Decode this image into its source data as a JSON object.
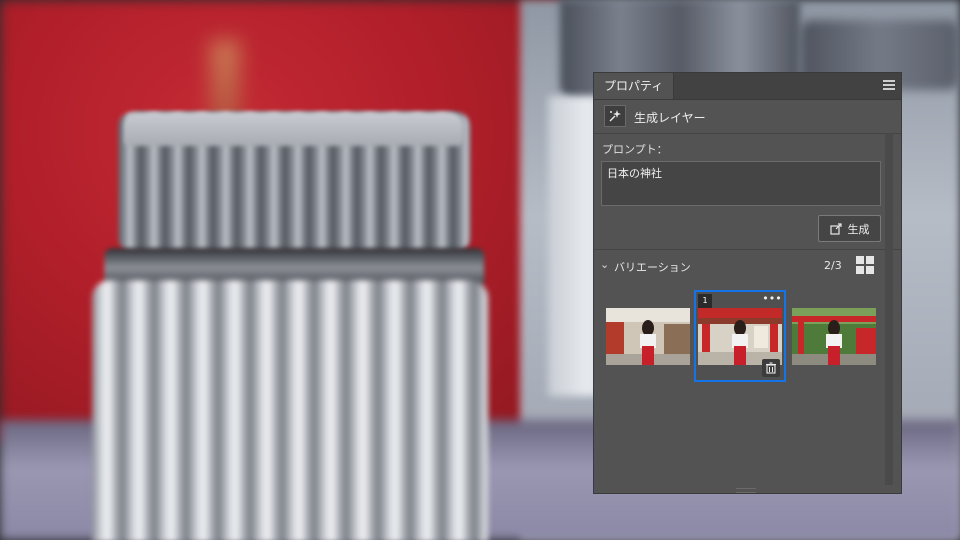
{
  "panel": {
    "tab_label": "プロパティ",
    "menu_icon": "hamburger-icon",
    "layer_type_icon": "generative-sparkle-icon",
    "layer_type_label": "生成レイヤー"
  },
  "prompt": {
    "label": "プロンプト：",
    "value": "日本の神社"
  },
  "generate_button": {
    "label": "生成",
    "icon": "generate-refresh-icon"
  },
  "variations": {
    "title": "バリエーション",
    "count": "2/3",
    "selected_index": 1,
    "selected_badge": "1"
  },
  "colors": {
    "accent": "#1473e6",
    "panel_bg": "#535353",
    "tab_bar_bg": "#424242",
    "field_bg": "#454545"
  }
}
